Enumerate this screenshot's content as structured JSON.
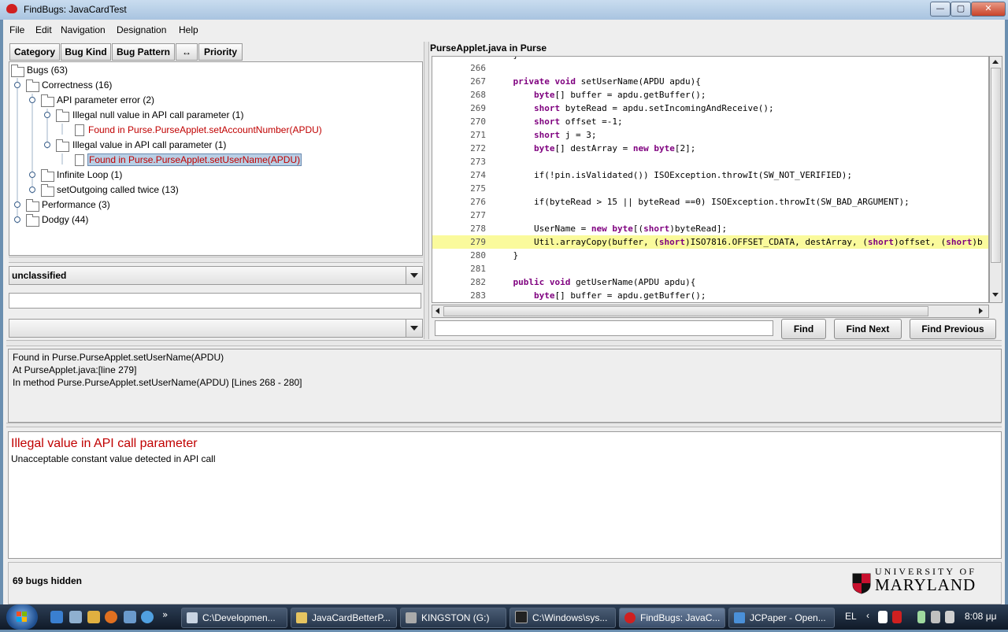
{
  "window": {
    "title": "FindBugs: JavaCardTest",
    "minimize": "—",
    "maximize": "▢",
    "close": "✕"
  },
  "menu": [
    "File",
    "Edit",
    "Navigation",
    "Designation",
    "Help"
  ],
  "sort_tabs": [
    "Category",
    "Bug Kind",
    "Bug Pattern",
    "↔",
    "Priority"
  ],
  "tree": {
    "root": "Bugs (63)",
    "correctness": "Correctness (16)",
    "api_param_error": "API parameter error (2)",
    "illegal_null": "Illegal null value in API call parameter (1)",
    "found_account": "Found in Purse.PurseApplet.setAccountNumber(APDU)",
    "illegal_value": "Illegal value in API call parameter (1)",
    "found_username": "Found in Purse.PurseApplet.setUserName(APDU)",
    "infinite_loop": "Infinite Loop (1)",
    "set_outgoing": "setOutgoing called twice (13)",
    "performance": "Performance (3)",
    "dodgy": "Dodgy (44)"
  },
  "designation": {
    "selected": "unclassified",
    "comment": "",
    "history": ""
  },
  "code": {
    "header": "PurseApplet.java in Purse",
    "partial_top_line": "}",
    "lines": [
      {
        "n": "266",
        "t": ""
      },
      {
        "n": "267",
        "t": "    private void setUserName(APDU apdu){"
      },
      {
        "n": "268",
        "t": "        byte[] buffer = apdu.getBuffer();"
      },
      {
        "n": "269",
        "t": "        short byteRead = apdu.setIncomingAndReceive();"
      },
      {
        "n": "270",
        "t": "        short offset =-1;"
      },
      {
        "n": "271",
        "t": "        short j = 3;"
      },
      {
        "n": "272",
        "t": "        byte[] destArray = new byte[2];"
      },
      {
        "n": "273",
        "t": ""
      },
      {
        "n": "274",
        "t": "        if(!pin.isValidated()) ISOException.throwIt(SW_NOT_VERIFIED);"
      },
      {
        "n": "275",
        "t": ""
      },
      {
        "n": "276",
        "t": "        if(byteRead > 15 || byteRead ==0) ISOException.throwIt(SW_BAD_ARGUMENT);"
      },
      {
        "n": "277",
        "t": ""
      },
      {
        "n": "278",
        "t": "        UserName = new byte[(short)byteRead];"
      },
      {
        "n": "279",
        "t": "        Util.arrayCopy(buffer, (short)ISO7816.OFFSET_CDATA, destArray, (short)offset, (short)b"
      },
      {
        "n": "280",
        "t": "    }"
      },
      {
        "n": "281",
        "t": ""
      },
      {
        "n": "282",
        "t": "    public void getUserName(APDU apdu){"
      },
      {
        "n": "283",
        "t": "        byte[] buffer = apdu.getBuffer();"
      }
    ],
    "highlight_line": "279"
  },
  "find": {
    "query": "",
    "find_label": "Find",
    "find_next_label": "Find Next",
    "find_previous_label": "Find Previous"
  },
  "summary": {
    "line1": "Found in Purse.PurseApplet.setUserName(APDU)",
    "line2": "At PurseApplet.java:[line 279]",
    "line3": "In method Purse.PurseApplet.setUserName(APDU) [Lines 268 - 280]"
  },
  "details": {
    "title": "Illegal value in API call parameter",
    "description": "Unacceptable constant value detected in API call"
  },
  "status": {
    "hidden": "69 bugs hidden",
    "logo_line1": "UNIVERSITY OF",
    "logo_line2": "MARYLAND"
  },
  "taskbar": {
    "tasks": [
      "C:\\Developmen...",
      "JavaCardBetterP...",
      "KINGSTON (G:)",
      "C:\\Windows\\sys...",
      "FindBugs: JavaC...",
      "JCPaper - Open..."
    ],
    "lang": "EL",
    "clock": "8:08 μμ",
    "quick_more": "»"
  },
  "colors": {
    "highlight": "#fafa9c",
    "bug_red": "#c00000",
    "keyword": "#7f007f"
  }
}
